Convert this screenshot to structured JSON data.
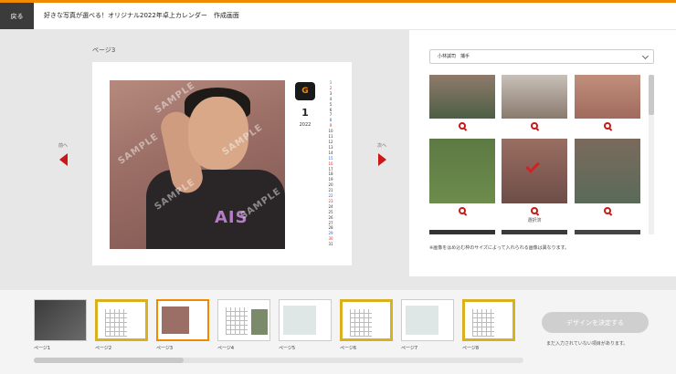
{
  "header": {
    "back_label": "戻る",
    "title": "好きな写真が選べる！オリジナル2022年卓上カレンダー　作成画面"
  },
  "editor": {
    "page_label": "ページ3",
    "prev_label": "前へ",
    "next_label": "次へ",
    "watermark": "SAMPLE",
    "photo_text": "AIS",
    "calendar": {
      "month": "1",
      "year": "2022",
      "days": [
        "1",
        "2",
        "3",
        "4",
        "5",
        "6",
        "7",
        "8",
        "9",
        "10",
        "11",
        "12",
        "13",
        "14",
        "15",
        "16",
        "17",
        "18",
        "19",
        "20",
        "21",
        "22",
        "23",
        "24",
        "25",
        "26",
        "27",
        "28",
        "29",
        "30",
        "31"
      ]
    }
  },
  "photo_panel": {
    "player_select": "小林誠司　捕手",
    "selected_label": "選択済",
    "notice": "※画像をはめ込む枠のサイズによって入れられる画像は異なります。"
  },
  "pages": [
    {
      "label": "ページ1"
    },
    {
      "label": "ページ2"
    },
    {
      "label": "ページ3"
    },
    {
      "label": "ページ4"
    },
    {
      "label": "ページ5"
    },
    {
      "label": "ページ6"
    },
    {
      "label": "ページ7"
    },
    {
      "label": "ページ8"
    }
  ],
  "footer": {
    "decide_label": "デザインを決定する",
    "decide_note": "まだ入力されていない項目があります。"
  },
  "colors": {
    "accent": "#f08a00",
    "arrow": "#c81818",
    "button_disabled": "#cfcfcf"
  }
}
